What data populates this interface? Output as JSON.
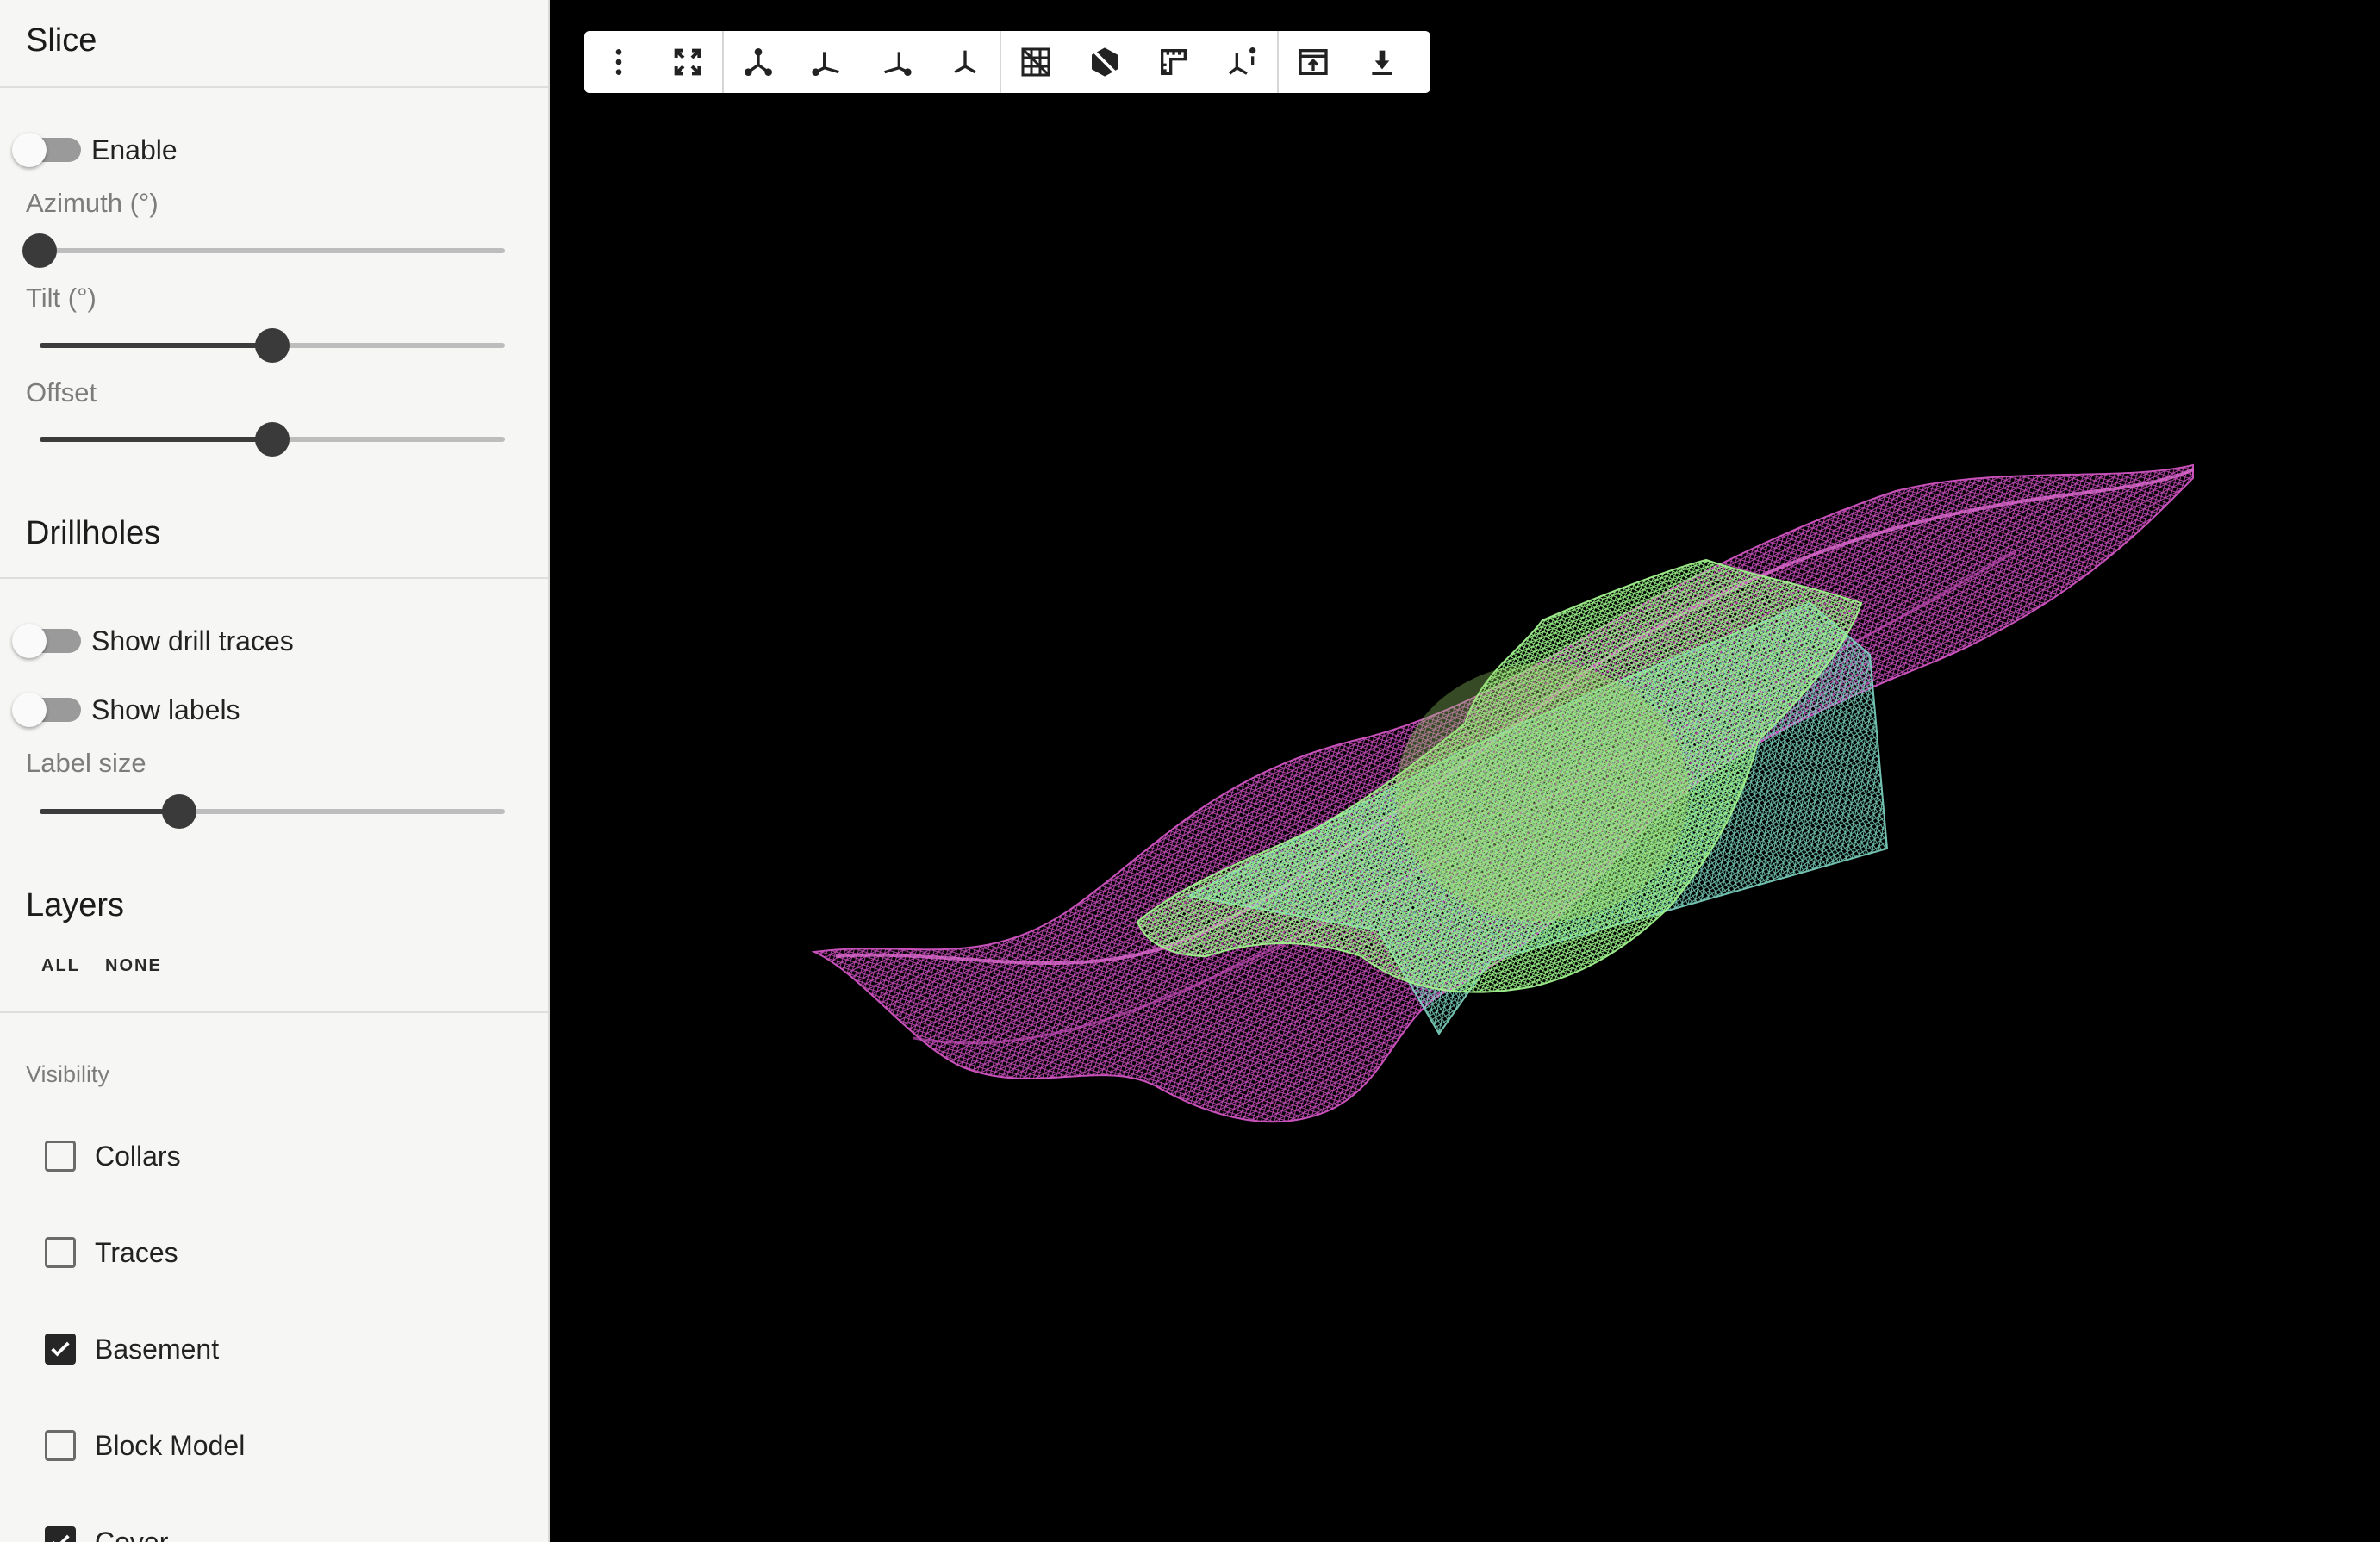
{
  "slice": {
    "title": "Slice",
    "enable_label": "Enable",
    "enable_on": false,
    "azimuth_label": "Azimuth (°)",
    "azimuth_value": 0,
    "tilt_label": "Tilt (°)",
    "tilt_value": 0.5,
    "offset_label": "Offset",
    "offset_value": 0.5
  },
  "drillholes": {
    "title": "Drillholes",
    "show_traces_label": "Show drill traces",
    "show_traces_on": false,
    "show_labels_label": "Show labels",
    "show_labels_on": false,
    "label_size_label": "Label size",
    "label_size_value": 0.3
  },
  "layers": {
    "title": "Layers",
    "all_label": "ALL",
    "none_label": "NONE",
    "visibility_label": "Visibility",
    "items": [
      {
        "label": "Collars",
        "checked": false
      },
      {
        "label": "Traces",
        "checked": false
      },
      {
        "label": "Basement",
        "checked": true
      },
      {
        "label": "Block Model",
        "checked": false
      },
      {
        "label": "Cover",
        "checked": true
      }
    ]
  },
  "toolbar": {
    "groups": [
      [
        "more-vert-icon",
        "fullscreen-icon"
      ],
      [
        "view-axes-iso-icon",
        "view-axes-left-icon",
        "view-axes-right-icon",
        "view-axes-top-icon"
      ],
      [
        "grid-off-icon",
        "hide-box-icon",
        "ruler-icon",
        "axes-info-icon"
      ],
      [
        "open-in-new-icon",
        "download-icon"
      ]
    ]
  },
  "viewport": {
    "background": "#000000",
    "surface_color": "#c545b8",
    "basement_color": "#8ef07a",
    "block_color": "#7fe0c8"
  }
}
